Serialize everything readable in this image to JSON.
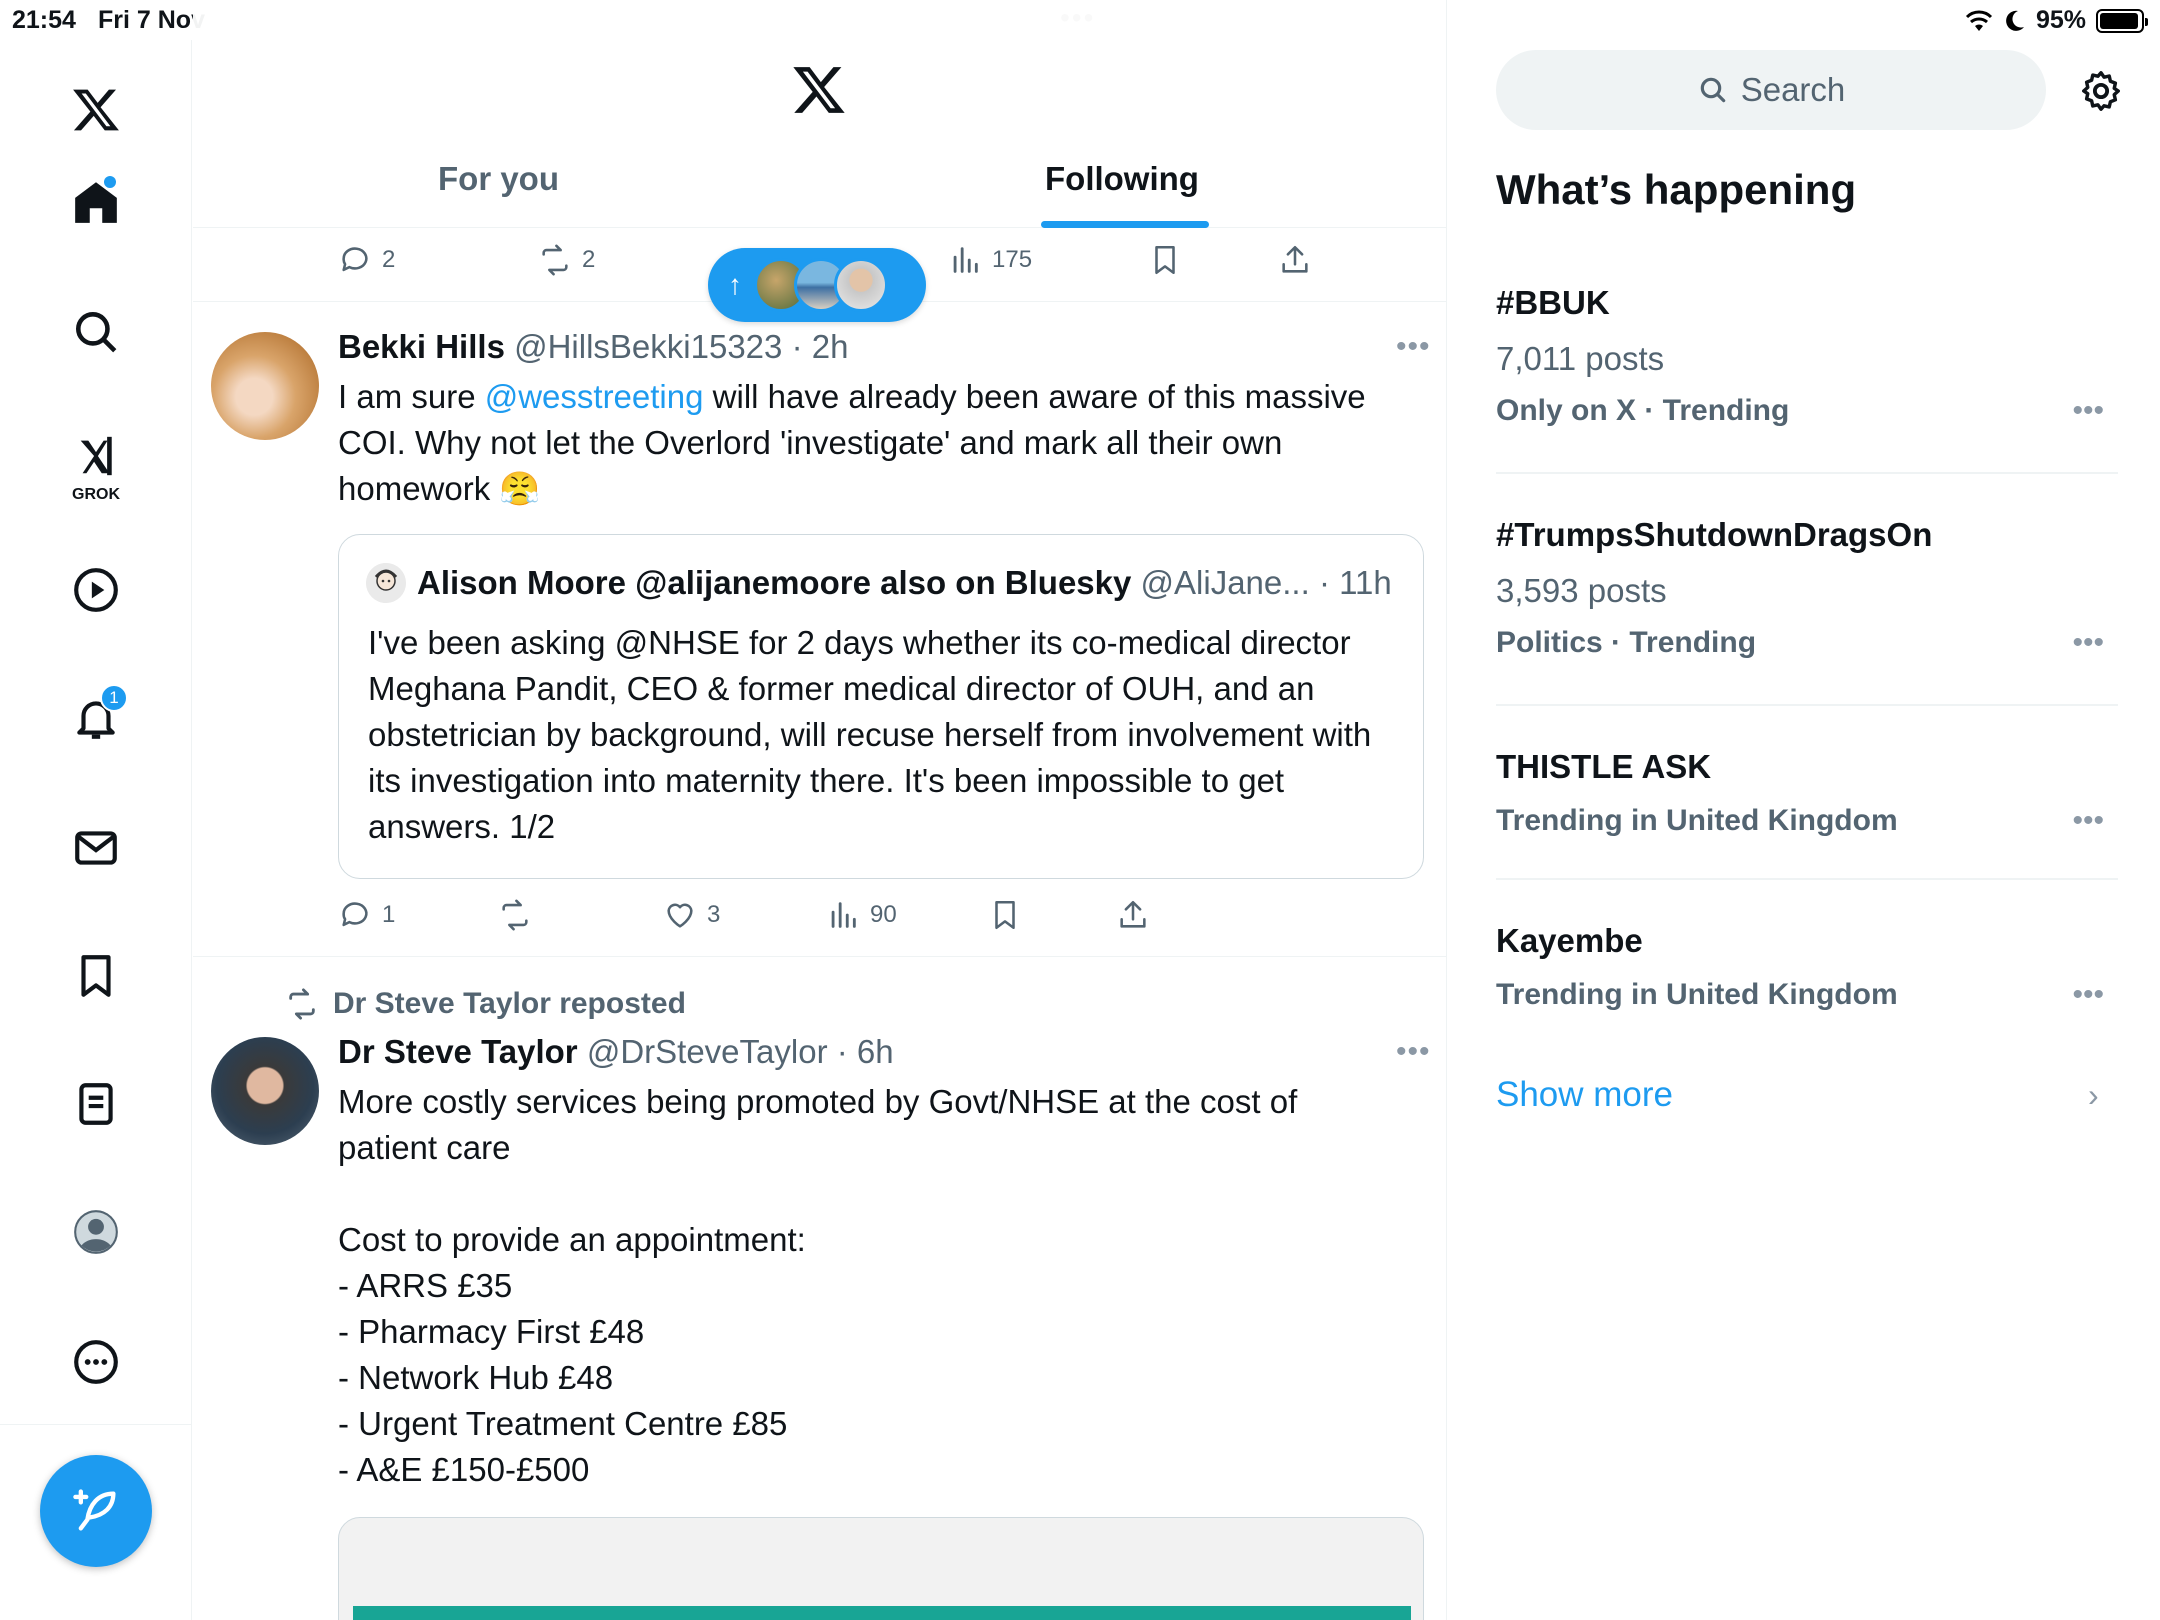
{
  "status_bar": {
    "time": "21:54",
    "date": "Fri 7 Nov",
    "battery": "95%",
    "battery_level": 0.95
  },
  "nav": {
    "items": [
      {
        "name": "x-logo",
        "label": "X"
      },
      {
        "name": "home",
        "label": "Home"
      },
      {
        "name": "explore",
        "label": "Explore"
      },
      {
        "name": "grok",
        "label": "GROK"
      },
      {
        "name": "video",
        "label": "Video"
      },
      {
        "name": "notifications",
        "label": "Notifications"
      },
      {
        "name": "messages",
        "label": "Messages"
      },
      {
        "name": "bookmarks",
        "label": "Bookmarks"
      },
      {
        "name": "lists",
        "label": "Lists"
      },
      {
        "name": "profile",
        "label": "Profile"
      },
      {
        "name": "more",
        "label": "More"
      }
    ],
    "grok_label": "GROK",
    "notifications_badge": "1",
    "accent_color": "#1d9bf0"
  },
  "header": {
    "tabs": [
      {
        "label": "For you",
        "active": false
      },
      {
        "label": "Following",
        "active": true
      }
    ]
  },
  "top_actions": {
    "replies": "2",
    "reposts": "2",
    "views": "175"
  },
  "tweets": [
    {
      "name": "Bekki Hills",
      "handle": "@HillsBekki15323",
      "time": "· 2h",
      "text_prefix": "I am sure ",
      "mention": "@wesstreeting",
      "text_suffix": " will have already been aware of this massive COI. Why not let the Overlord 'investigate' and mark all their own homework 😤",
      "quote": {
        "name": "Alison Moore @alijanemoore also on Bluesky",
        "handle": "@AliJane...",
        "time": "· 11h",
        "text": "I've been asking @NHSE for 2 days whether its  co-medical director Meghana Pandit, CEO & former medical director of OUH, and an obstetrician by background, will recuse herself from involvement with its investigation into maternity there. It's been impossible to get answers. 1/2"
      },
      "replies": "1",
      "reposts": "",
      "likes": "3",
      "views": "90"
    },
    {
      "reposted_by": "Dr Steve Taylor reposted",
      "name": "Dr Steve Taylor",
      "handle": "@DrSteveTaylor",
      "time": "· 6h",
      "text": "More costly services being promoted by Govt/NHSE at the cost of patient care\n\nCost to provide an appointment:\n- ARRS £35\n- Pharmacy First £48\n- Network Hub £48\n- Urgent Treatment Centre £85\n- A&E £150-£500"
    }
  ],
  "sidebar": {
    "search_placeholder": "Search",
    "title": "What’s happening",
    "trends": [
      {
        "name": "#BBUK",
        "posts": "7,011 posts",
        "context": "Only on X · Trending"
      },
      {
        "name": "#TrumpsShutdownDragsOn",
        "posts": "3,593 posts",
        "context": "Politics · Trending"
      },
      {
        "name": "THISTLE ASK",
        "posts": "",
        "context": "Trending in United Kingdom"
      },
      {
        "name": "Kayembe",
        "posts": "",
        "context": "Trending in United Kingdom"
      }
    ],
    "show_more": "Show more"
  }
}
